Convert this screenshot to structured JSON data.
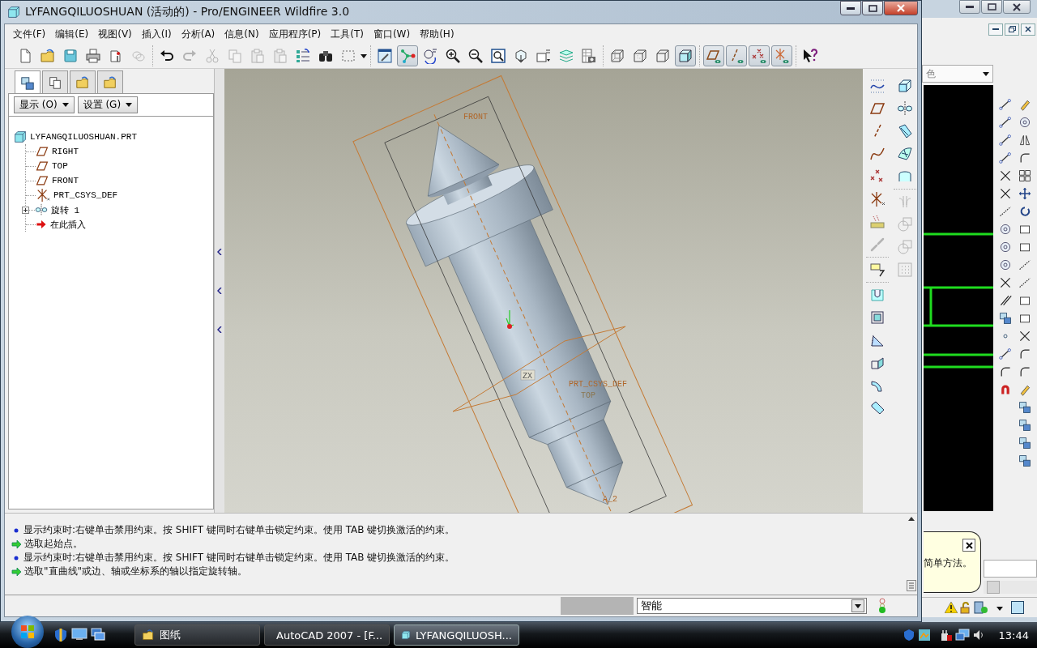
{
  "window": {
    "title": "LYFANGQILUOSHUAN (活动的) - Pro/ENGINEER Wildfire 3.0"
  },
  "menu": [
    "文件(F)",
    "编辑(E)",
    "视图(V)",
    "插入(I)",
    "分析(A)",
    "信息(N)",
    "应用程序(P)",
    "工具(T)",
    "窗口(W)",
    "帮助(H)"
  ],
  "toolbar": [
    [
      {
        "on": false,
        "disabled": false
      },
      {
        "on": false,
        "disabled": false
      },
      {
        "on": false,
        "disabled": false
      },
      {
        "on": false,
        "disabled": false
      },
      {
        "on": false,
        "disabled": false
      },
      {
        "on": false,
        "disabled": true
      }
    ],
    [
      {
        "on": false,
        "disabled": false
      },
      {
        "on": false,
        "disabled": true
      },
      {
        "on": false,
        "disabled": true
      },
      {
        "on": false,
        "disabled": true
      },
      {
        "on": false,
        "disabled": true
      },
      {
        "on": false,
        "disabled": true
      },
      {
        "on": false,
        "disabled": false
      },
      {
        "on": false,
        "disabled": false
      },
      {
        "on": false,
        "disabled": false
      }
    ],
    [
      {
        "on": false,
        "disabled": false
      },
      {
        "on": true,
        "disabled": false
      },
      {
        "on": false,
        "disabled": false
      },
      {
        "on": false,
        "disabled": false
      },
      {
        "on": false,
        "disabled": false
      },
      {
        "on": false,
        "disabled": false
      },
      {
        "on": false,
        "disabled": false
      },
      {
        "on": false,
        "disabled": false
      },
      {
        "on": false,
        "disabled": false
      },
      {
        "on": false,
        "disabled": false
      }
    ],
    [
      {
        "on": false,
        "disabled": false
      },
      {
        "on": false,
        "disabled": false
      },
      {
        "on": false,
        "disabled": false
      },
      {
        "on": true,
        "disabled": false
      }
    ],
    [
      {
        "on": true,
        "disabled": false
      },
      {
        "on": true,
        "disabled": false
      },
      {
        "on": true,
        "disabled": false
      },
      {
        "on": true,
        "disabled": false
      }
    ],
    [
      {
        "on": false,
        "disabled": false
      }
    ]
  ],
  "navigator": {
    "tabs": [
      {
        "selected": true
      },
      {
        "selected": false
      },
      {
        "selected": false
      },
      {
        "selected": false
      }
    ],
    "buttons": [
      "显示 (O)",
      "设置 (G)"
    ],
    "tree": {
      "label": "LYFANGQILUOSHUAN.PRT",
      "kind": "part",
      "children": [
        {
          "label": "RIGHT",
          "kind": "plane"
        },
        {
          "label": "TOP",
          "kind": "plane"
        },
        {
          "label": "FRONT",
          "kind": "plane"
        },
        {
          "label": "PRT_CSYS_DEF",
          "kind": "csys"
        },
        {
          "label": "旋转 1",
          "kind": "revolve",
          "expanded": false
        },
        {
          "label": "在此插入",
          "kind": "insert"
        }
      ]
    }
  },
  "graphics": {
    "datum_labels": [
      "FRONT",
      "PRT_CSYS_DEF",
      "TOP",
      "ZX",
      "A_2"
    ]
  },
  "right_toolbar": {
    "column_1": [
      [
        {
          "disabled": false
        },
        {
          "disabled": false
        },
        {
          "disabled": false
        },
        {
          "disabled": false
        },
        {
          "disabled": false
        },
        {
          "disabled": false
        },
        {
          "disabled": false
        },
        {
          "disabled": true
        }
      ],
      [
        {
          "disabled": false
        }
      ],
      [
        {
          "disabled": false
        },
        {
          "disabled": false
        },
        {
          "disabled": false
        },
        {
          "disabled": false
        },
        {
          "disabled": false
        },
        {
          "disabled": false
        }
      ]
    ],
    "column_2": [
      [
        {
          "disabled": false
        },
        {
          "disabled": false
        },
        {
          "disabled": false
        },
        {
          "disabled": false
        },
        {
          "disabled": false
        }
      ],
      [
        {
          "disabled": true
        },
        {
          "disabled": true
        },
        {
          "disabled": true
        },
        {
          "disabled": true
        }
      ]
    ]
  },
  "messages": [
    {
      "kind": "info",
      "text": "显示约束时:右键单击禁用约束。按 SHIFT 键同时右键单击锁定约束。使用 TAB 键切换激活的约束。"
    },
    {
      "kind": "prompt",
      "text": "选取起始点。"
    },
    {
      "kind": "info",
      "text": "显示约束时:右键单击禁用约束。按 SHIFT 键同时右键单击锁定约束。使用 TAB 键切换激活的约束。"
    },
    {
      "kind": "prompt",
      "text": "选取\"直曲线\"或边、轴或坐标系的轴以指定旋转轴。"
    }
  ],
  "status_bar": {
    "filter": "智能"
  },
  "background_window": {
    "dropdown": "色",
    "tooltip": "简单方法。"
  },
  "taskbar": {
    "buttons": [
      {
        "label": "图纸",
        "selected": false
      },
      {
        "label": "AutoCAD 2007 - [F...",
        "selected": false
      },
      {
        "label": "LYFANGQILUOSH...",
        "selected": true
      }
    ],
    "clock": "13:44"
  }
}
